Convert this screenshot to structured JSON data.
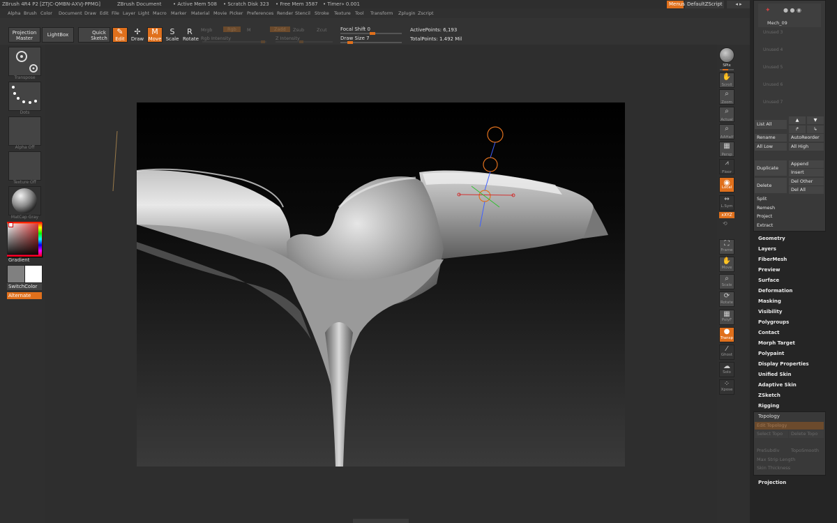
{
  "titlebar": {
    "app": "ZBrush 4R4 P2 [ZTJC-QMBN-AXVJ-PPMG]",
    "doc": "ZBrush Document",
    "active_mem": "• Active Mem 508",
    "scratch_disk": "• Scratch Disk 323",
    "free_mem": "• Free Mem 3587",
    "timer": "• Timer» 0.001",
    "menus_btn": "Menus",
    "default_script": "DefaultZScript",
    "window_controls": "◂ ▸"
  },
  "menubar": [
    "Alpha",
    "Brush",
    "Color",
    "Document",
    "Draw",
    "Edit",
    "File",
    "Layer",
    "Light",
    "Macro",
    "Marker",
    "Material",
    "Movie",
    "Picker",
    "Preferences",
    "Render",
    "Stencil",
    "Stroke",
    "Texture",
    "Tool",
    "Transform",
    "Zplugin",
    "Zscript"
  ],
  "toolbar": {
    "projection_master": "Projection Master",
    "lightbox": "LightBox",
    "quick_sketch": "Quick Sketch",
    "edit": "Edit",
    "draw": "Draw",
    "move": "Move",
    "scale": "Scale",
    "rotate": "Rotate",
    "mrgb": "Mrgb",
    "rgb": "Rgb",
    "m": "M",
    "rgb_intensity": "Rgb Intensity",
    "zadd": "Zadd",
    "zsub": "Zsub",
    "zcut": "Zcut",
    "z_intensity": "Z Intensity",
    "focal_shift": "Focal Shift 0",
    "draw_size": "Draw Size 7",
    "active_points": "ActivePoints: 6,193",
    "total_points": "TotalPoints: 1.492 Mil"
  },
  "left_shelf": {
    "transpose": "Transpose",
    "dots": "Dots",
    "alpha": "Alpha Off",
    "texture": "Texture Off",
    "matcap": "MatCap Gray",
    "gradient": "Gradient",
    "switch_color": "SwitchColor",
    "alternate": "Alternate"
  },
  "right_shelf": [
    "BPR",
    "SPix",
    "Scroll",
    "Zoom",
    "Actual",
    "AAHalf",
    "Persp",
    "Floor",
    "Local",
    "L.Sym",
    "xXYZ",
    "",
    "Frame",
    "Move",
    "Scale",
    "Rotate",
    "PolyF",
    "Transp",
    "Ghost",
    "Solo",
    "Xpose"
  ],
  "subtool": {
    "active": "Mech_09",
    "unused": [
      "Unused 3",
      "Unused 4",
      "Unused 5",
      "Unused 6",
      "Unused 7"
    ],
    "list_all": "List All",
    "rename": "Rename",
    "auto_reorder": "AutoReorder",
    "all_low": "All Low",
    "all_high": "All High",
    "duplicate": "Duplicate",
    "append": "Append",
    "insert": "Insert",
    "delete": "Delete",
    "del_other": "Del Other",
    "del_all": "Del All",
    "split": "Split",
    "remesh": "Remesh",
    "project": "Project",
    "extract": "Extract"
  },
  "tool_menu": [
    "Geometry",
    "Layers",
    "FiberMesh",
    "Preview",
    "Surface",
    "Deformation",
    "Masking",
    "Visibility",
    "Polygroups",
    "Contact",
    "Morph Target",
    "Polypaint",
    "Display Properties",
    "Unified Skin",
    "Adaptive Skin",
    "ZSketch",
    "Rigging"
  ],
  "topology": {
    "header": "Topology",
    "edit_topology": "Edit Topology",
    "select_topo": "Select Topo",
    "delete_topo": "Delete Topo",
    "presubdiv": "PreSubdiv",
    "topo_smooth": "TopoSmooth",
    "max_strip_length": "Max Strip Length",
    "skin_thickness": "Skin Thickness"
  },
  "projection": "Projection",
  "colors": {
    "accent": "#e0701c",
    "bg": "#2b2b2b",
    "panel": "#393939"
  }
}
